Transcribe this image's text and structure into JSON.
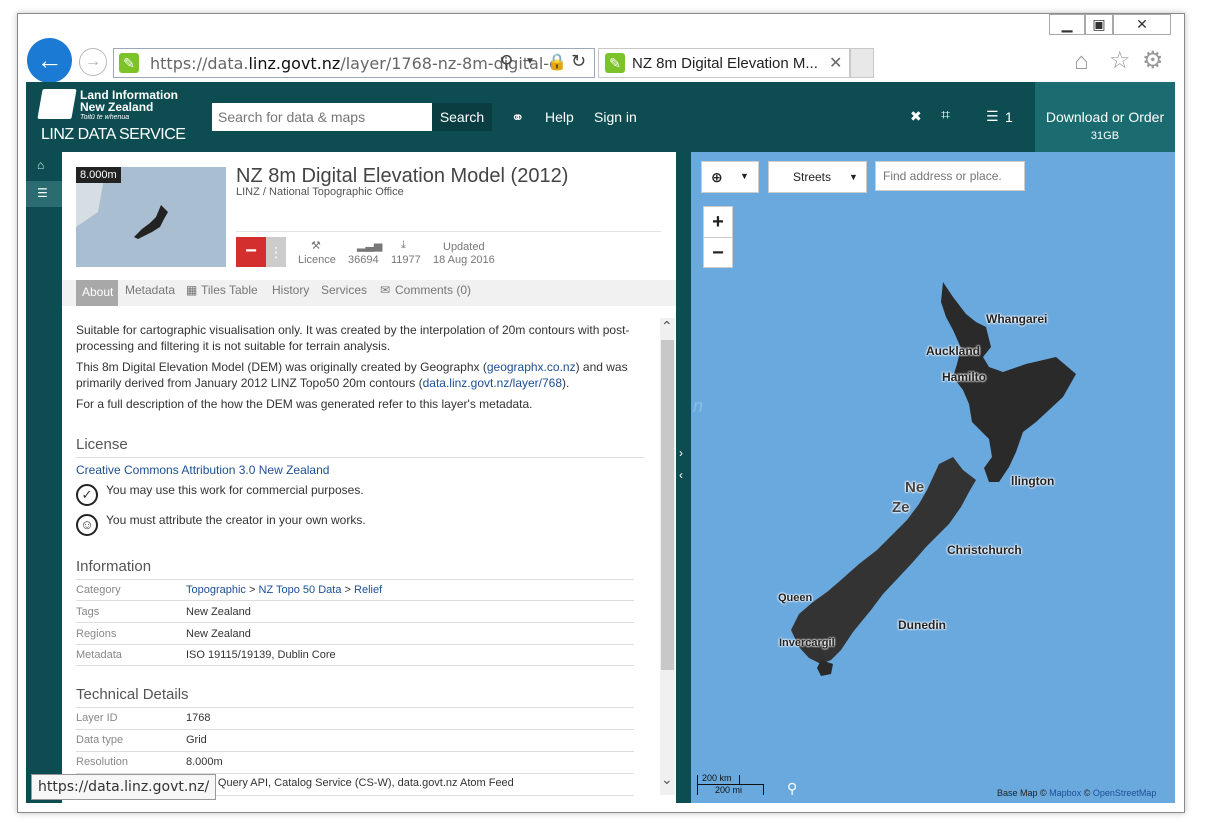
{
  "browser": {
    "url_prefix": "https://data.",
    "url_domain": "linz.govt.nz",
    "url_path": "/layer/1768-nz-8m-digital-e",
    "tab_title": "NZ 8m Digital Elevation M...",
    "status_url": "https://data.linz.govt.nz/"
  },
  "header": {
    "logo_line1": "Land Information",
    "logo_line2": "New Zealand",
    "logo_line3": "Toitū te whenua",
    "logo_service": "LINZ DATA SERVICE",
    "search_placeholder": "Search for data & maps",
    "search_button": "Search",
    "help": "Help",
    "sign_in": "Sign in",
    "list_count": "1",
    "download_label": "Download or Order",
    "download_size": "31GB"
  },
  "layer": {
    "thumb_label": "8.000m",
    "title": "NZ 8m Digital Elevation Model (2012)",
    "publisher": "LINZ / National Topographic Office",
    "licence_label": "Licence",
    "views_count": "36694",
    "downloads_count": "11977",
    "updated_label": "Updated",
    "updated_date": "18 Aug 2016"
  },
  "tabs": [
    "About",
    "Metadata",
    "Tiles Table",
    "History",
    "Services",
    "Comments (0)"
  ],
  "about": {
    "para1": "Suitable for cartographic visualisation only. It was created by the interpolation of 20m contours with post-processing and filtering it is not suitable for terrain analysis.",
    "para2_a": "This 8m Digital Elevation Model (DEM) was originally created by Geographx (",
    "para2_link1": "geographx.co.nz",
    "para2_b": ") and was primarily derived from January 2012 LINZ Topo50 20m contours (",
    "para2_link2": "data.linz.govt.nz/layer/768",
    "para2_c": ").",
    "para3": "For a full description of the how the DEM was generated refer to this layer's metadata."
  },
  "license": {
    "heading": "License",
    "name": "Creative Commons Attribution 3.0 New Zealand",
    "item1": "You may use this work for commercial purposes.",
    "item2": "You must attribute the creator in your own works."
  },
  "information": {
    "heading": "Information",
    "category_label": "Category",
    "category_1": "Topographic",
    "category_sep": ">",
    "category_2": "NZ Topo 50 Data",
    "category_3": "Relief",
    "tags_label": "Tags",
    "tags_value": "New Zealand",
    "regions_label": "Regions",
    "regions_value": "New Zealand",
    "metadata_label": "Metadata",
    "metadata_value": "ISO 19115/19139, Dublin Core"
  },
  "technical": {
    "heading": "Technical Details",
    "layer_id_label": "Layer ID",
    "layer_id_value": "1768",
    "data_type_label": "Data type",
    "data_type_value": "Grid",
    "resolution_label": "Resolution",
    "resolution_value": "8.000m",
    "services_value_partial": "ter Query API, Catalog Service (CS-W), data.govt.nz Atom Feed"
  },
  "map": {
    "basemap_select": "Streets",
    "find_placeholder": "Find address or place.",
    "zoom_in": "+",
    "zoom_out": "−",
    "cities": {
      "whangarei": "Whangarei",
      "auckland": "Auckland",
      "hamilton": "Hamilto",
      "wellington": "llington",
      "new_zealand_1": "Ne",
      "new_zealand_2": "Ze",
      "christchurch": "Christchurch",
      "queenstown": "Queen",
      "dunedin": "Dunedin",
      "invercargill": "Invercargil"
    },
    "scale_km": "200 km",
    "scale_mi": "200 mi",
    "attribution_prefix": "Base Map ©",
    "attribution_mapbox": "Mapbox",
    "attribution_sep": "©",
    "attribution_osm": "OpenStreetMap",
    "side_letter": "n"
  },
  "colors": {
    "header_bg": "#0d4d52",
    "download_bg": "#1a6c70",
    "map_water": "#6aa9de",
    "link": "#1c4f95",
    "remove_btn": "#d32f2f"
  }
}
